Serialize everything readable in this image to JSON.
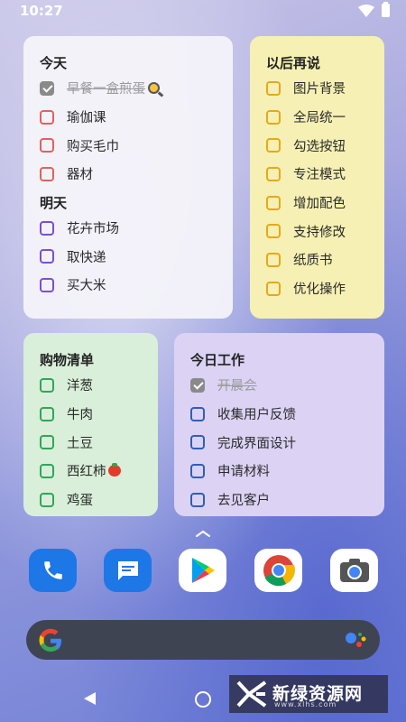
{
  "status_bar": {
    "time": "10:27"
  },
  "widgets": {
    "today": {
      "title": "今天",
      "items": [
        {
          "label": "早餐一盒煎蛋",
          "done": true
        },
        {
          "label": "瑜伽课",
          "done": false
        },
        {
          "label": "购买毛巾",
          "done": false
        },
        {
          "label": "器材",
          "done": false
        }
      ],
      "tomorrow_title": "明天",
      "tomorrow_items": [
        {
          "label": "花卉市场"
        },
        {
          "label": "取快递"
        },
        {
          "label": "买大米"
        }
      ]
    },
    "later": {
      "title": "以后再说",
      "items": [
        {
          "label": "图片背景"
        },
        {
          "label": "全局统一"
        },
        {
          "label": "勾选按钮"
        },
        {
          "label": "专注模式"
        },
        {
          "label": "增加配色"
        },
        {
          "label": "支持修改"
        },
        {
          "label": "纸质书"
        },
        {
          "label": "优化操作"
        }
      ]
    },
    "shopping": {
      "title": "购物清单",
      "items": [
        {
          "label": "洋葱"
        },
        {
          "label": "牛肉"
        },
        {
          "label": "土豆"
        },
        {
          "label": "西红柿"
        },
        {
          "label": "鸡蛋"
        }
      ]
    },
    "work": {
      "title": "今日工作",
      "items": [
        {
          "label": "开晨会",
          "done": true
        },
        {
          "label": "收集用户反馈",
          "done": false
        },
        {
          "label": "完成界面设计",
          "done": false
        },
        {
          "label": "申请材料",
          "done": false
        },
        {
          "label": "去见客户",
          "done": false
        }
      ]
    }
  },
  "dock": [
    "phone-icon",
    "messages-icon",
    "play-store-icon",
    "chrome-icon",
    "camera-icon"
  ],
  "watermark": {
    "text": "新绿资源网",
    "url": "www.xlhs.com"
  },
  "colors": {
    "today": "#e0625a",
    "tomorrow": "#7a4fd0",
    "later": "#e8a817",
    "shopping": "#2fa65a",
    "work": "#2f5fb8"
  }
}
